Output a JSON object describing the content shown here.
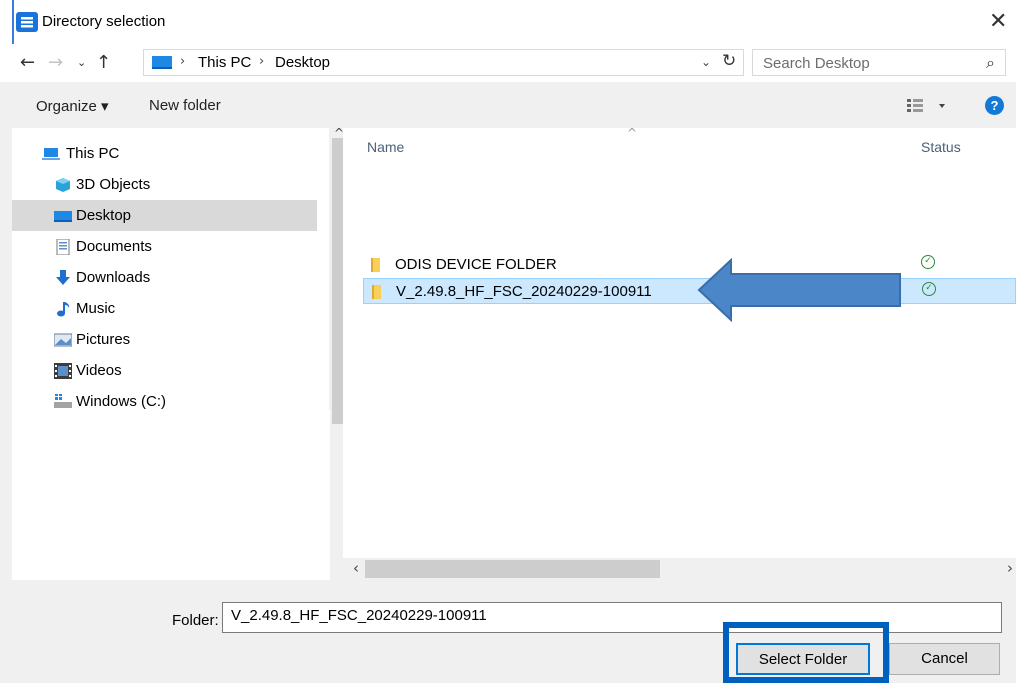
{
  "window": {
    "title": "Directory selection",
    "close_glyph": "✕",
    "icon": "app-icon"
  },
  "nav": {
    "back_glyph": "←",
    "forward_glyph": "→",
    "recent_glyph": "⌄",
    "up_glyph": "↑",
    "breadcrumbs": [
      "This PC",
      "Desktop"
    ],
    "crumb_sep": "›",
    "dropdown_glyph": "⌄",
    "refresh_glyph": "↻",
    "search_placeholder": "Search Desktop",
    "search_glyph": "⌕"
  },
  "toolbar": {
    "organize_label": "Organize ▾",
    "new_folder_label": "New folder",
    "help_label": "?"
  },
  "tree": {
    "items": [
      {
        "label": "This PC",
        "icon": "computer-icon",
        "selected": false
      },
      {
        "label": "3D Objects",
        "icon": "cube-icon",
        "selected": false
      },
      {
        "label": "Desktop",
        "icon": "desktop-icon",
        "selected": true
      },
      {
        "label": "Documents",
        "icon": "document-icon",
        "selected": false
      },
      {
        "label": "Downloads",
        "icon": "download-arrow-icon",
        "selected": false
      },
      {
        "label": "Music",
        "icon": "music-note-icon",
        "selected": false
      },
      {
        "label": "Pictures",
        "icon": "picture-icon",
        "selected": false
      },
      {
        "label": "Videos",
        "icon": "video-icon",
        "selected": false
      },
      {
        "label": "Windows (C:)",
        "icon": "drive-icon",
        "selected": false
      }
    ],
    "scroll_up_glyph": "^"
  },
  "files": {
    "columns": {
      "name": "Name",
      "status": "Status"
    },
    "sort_glyph": "^",
    "rows": [
      {
        "name": "ODIS DEVICE FOLDER",
        "status_icon": "sync-ok-icon",
        "selected": false
      },
      {
        "name": "V_2.49.8_HF_FSC_20240229-100911",
        "status_icon": "sync-ok-icon",
        "selected": true
      }
    ],
    "status_glyph": "✓",
    "scroll_left_glyph": "‹",
    "scroll_right_glyph": "›"
  },
  "footer": {
    "folder_label": "Folder:",
    "folder_value": "V_2.49.8_HF_FSC_20240229-100911",
    "select_label": "Select Folder",
    "cancel_label": "Cancel"
  },
  "colors": {
    "accent": "#0078d7",
    "selection": "#cce8ff",
    "annotation": "#4a86c8"
  }
}
